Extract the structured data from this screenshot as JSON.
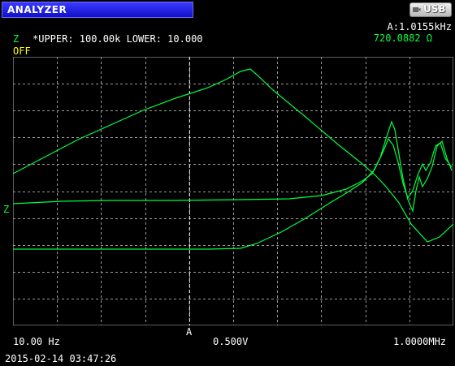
{
  "header": {
    "mode_title": "ANALYZER",
    "usb_label": "USB",
    "cursor_frequency": "A:1.0155kHz",
    "cursor_value": "720.0882 Ω"
  },
  "measurement": {
    "channel": "Z",
    "limits": "*UPPER: 100.00k LOWER: 10.000",
    "status": "OFF"
  },
  "plot": {
    "y_marker": "Z",
    "cursor_marker": "A",
    "x_start": "10.00 Hz",
    "x_mid": "0.500V",
    "x_end": "1.0000MHz",
    "cursor_fraction": 0.4,
    "trace_color": "#00ff40",
    "grid_color": "#9a9a9a"
  },
  "footer": {
    "timestamp": "2015-02-14 03:47:26"
  }
}
